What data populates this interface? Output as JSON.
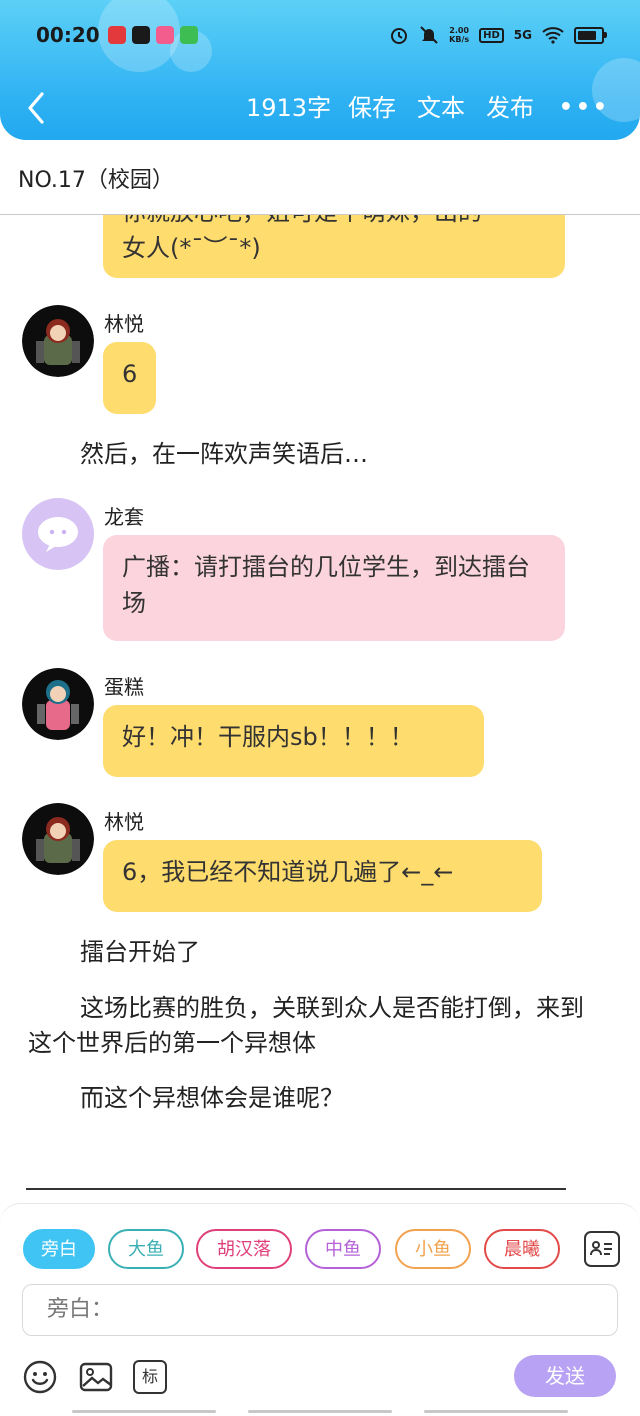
{
  "status_bar": {
    "time": "00:20",
    "net_speed_value": "2.00",
    "net_speed_unit": "KB/s",
    "hd": "HD",
    "signal": "5G",
    "app_icons": [
      "pinduoduo-icon",
      "tiktok-icon",
      "bilibili-icon",
      "tv-app-icon"
    ],
    "system_icons": [
      "alarm-icon",
      "mute-icon",
      "wifi-icon",
      "battery-icon"
    ]
  },
  "header": {
    "word_count": "1913字",
    "save": "保存",
    "text": "文本",
    "publish": "发布",
    "more": "•••"
  },
  "chapter": {
    "title": "NO.17（校园）"
  },
  "chat": {
    "partial_bubble_line1": "你就放心吧，姐可是个萌妹，出的",
    "partial_bubble_line2": "女人(*¯︶¯*)",
    "messages": [
      {
        "sender": "林悦",
        "text": "6"
      },
      {
        "narration": "然后，在一阵欢声笑语后…"
      },
      {
        "sender": "龙套",
        "text": "广播：请打擂台的几位学生，到达擂台场"
      },
      {
        "sender": "蛋糕",
        "text": "好！冲！干服内sb！！！！"
      },
      {
        "sender": "林悦",
        "text": "6，我已经不知道说几遍了←_←"
      },
      {
        "narration": "擂台开始了"
      },
      {
        "narration": "这场比赛的胜负，关联到众人是否能打倒，来到这个世界后的第一个异想体"
      },
      {
        "narration": "而这个异想体会是谁呢？"
      }
    ]
  },
  "roles": [
    {
      "label": "旁白",
      "color": "#3fc4f3",
      "selected": true
    },
    {
      "label": "大鱼",
      "color": "#3ab0b5"
    },
    {
      "label": "胡汉落",
      "color": "#e0407a"
    },
    {
      "label": "中鱼",
      "color": "#b561d8"
    },
    {
      "label": "小鱼",
      "color": "#f2a24f"
    },
    {
      "label": "晨曦",
      "color": "#e24a4a"
    }
  ],
  "input": {
    "value": "旁白："
  },
  "toolbar": {
    "emoji": "emoji-icon",
    "image": "image-icon",
    "mark": "标",
    "send": "发送"
  }
}
